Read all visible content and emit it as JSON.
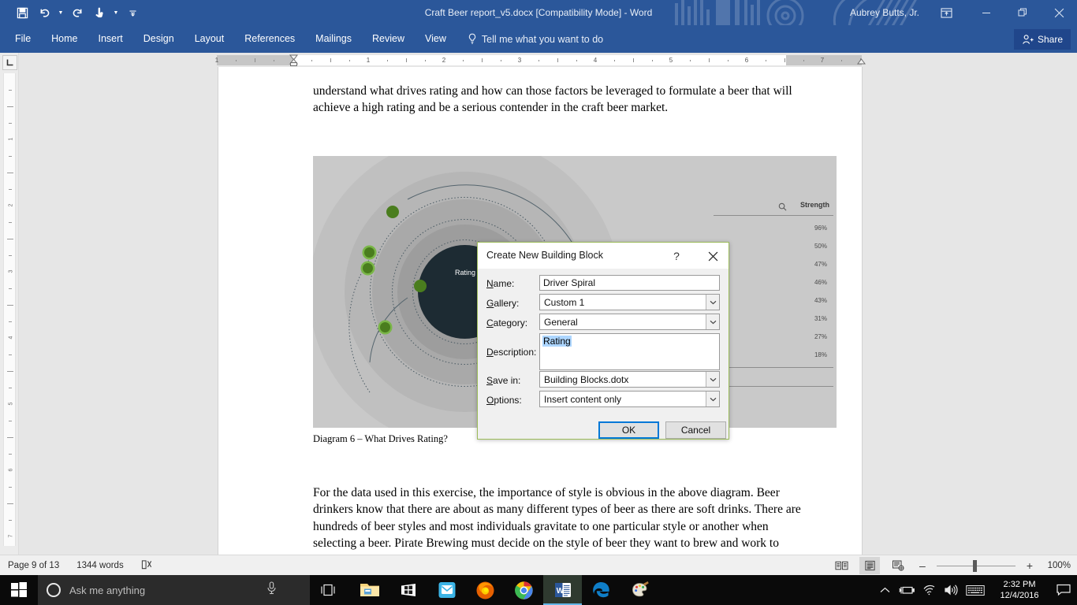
{
  "titlebar": {
    "document_title": "Craft Beer report_v5.docx [Compatibility Mode] - Word",
    "user": "Aubrey Butts, Jr.",
    "quick_access": [
      {
        "name": "save-icon",
        "label": "Save"
      },
      {
        "name": "undo-icon",
        "label": "Undo"
      },
      {
        "name": "redo-icon",
        "label": "Redo"
      },
      {
        "name": "touch-mouse-mode-icon",
        "label": "Touch/Mouse Mode"
      },
      {
        "name": "customize-quick-access-toolbar-icon",
        "label": "Customize Quick Access Toolbar"
      }
    ],
    "window_buttons": {
      "minimize": "–",
      "restore": "❐",
      "close": "✕"
    },
    "ribbon_display_options": "Ribbon Display Options",
    "accent_color": "#2b579a"
  },
  "ribbon": {
    "tabs": [
      {
        "label": "File"
      },
      {
        "label": "Home"
      },
      {
        "label": "Insert"
      },
      {
        "label": "Design"
      },
      {
        "label": "Layout"
      },
      {
        "label": "References"
      },
      {
        "label": "Mailings"
      },
      {
        "label": "Review"
      },
      {
        "label": "View"
      }
    ],
    "tell_me": "Tell me what you want to do",
    "share_label": "Share"
  },
  "ruler": {
    "horizontal_numbers": [
      "1",
      "1",
      "2",
      "3",
      "4",
      "5",
      "6",
      "7"
    ],
    "vertical_numbers": [
      "1",
      "2",
      "3",
      "4",
      "5",
      "6",
      "7"
    ]
  },
  "document": {
    "paragraph_1": "understand what drives rating and how can those factors be leveraged to formulate a beer that will achieve a high rating and be a serious contender in the craft beer market.",
    "caption": "Diagram 6 – What Drives Rating?",
    "paragraph_2": "For the data used in this exercise, the importance of style is obvious in the above diagram.  Beer drinkers know that there are about as many different types of beer as there are soft drinks.  There are hundreds of beer styles and most individuals gravitate to one particular style or another when selecting a beer.  Pirate Brewing must decide on the style of beer they want to brew and work to perfect their particular taste."
  },
  "chart_data": {
    "type": "scatter",
    "title": "What Drives Rating?",
    "center_label": "Rating",
    "column_header": "Strength",
    "values": [
      "96%",
      "50%",
      "47%",
      "46%",
      "43%",
      "31%",
      "27%",
      "18%"
    ],
    "grid": false,
    "legend": "none",
    "dot_color": "#4a7d1e",
    "center_color": "#1d2b33"
  },
  "dialog": {
    "title": "Create New Building Block",
    "help_glyph": "?",
    "close_glyph": "✕",
    "fields": [
      {
        "key": "name",
        "label": "Name:",
        "accel": "N",
        "value": "Driver Spiral",
        "type": "text"
      },
      {
        "key": "gallery",
        "label": "Gallery:",
        "accel": "G",
        "value": "Custom 1",
        "type": "combo"
      },
      {
        "key": "category",
        "label": "Category:",
        "accel": "C",
        "value": "General",
        "type": "combo"
      },
      {
        "key": "description",
        "label": "Description:",
        "accel": "D",
        "value": "Rating",
        "type": "textarea"
      },
      {
        "key": "save_in",
        "label": "Save in:",
        "accel": "S",
        "value": "Building Blocks.dotx",
        "type": "combo"
      },
      {
        "key": "options",
        "label": "Options:",
        "accel": "O",
        "value": "Insert content only",
        "type": "combo"
      }
    ],
    "ok_label": "OK",
    "cancel_label": "Cancel",
    "border_color": "#9bbb59",
    "selection_color": "#add6ff"
  },
  "statusbar": {
    "page": "Page 9 of 13",
    "words": "1344 words",
    "proofing_icon": "spelling-grammar-icon",
    "views": [
      {
        "name": "read-mode-view-button",
        "active": false
      },
      {
        "name": "print-layout-view-button",
        "active": true
      },
      {
        "name": "web-layout-view-button",
        "active": false
      }
    ],
    "zoom_out": "–",
    "zoom_in": "+",
    "zoom_level": "100%"
  },
  "taskbar": {
    "start": "start-button",
    "search_placeholder": "Ask me anything",
    "task_view": "task-view-button",
    "apps": [
      {
        "name": "file-explorer-icon",
        "label": "File Explorer",
        "active": false
      },
      {
        "name": "microsoft-store-icon",
        "label": "Microsoft Store",
        "active": false
      },
      {
        "name": "mail-icon",
        "label": "Mail",
        "active": false
      },
      {
        "name": "firefox-icon",
        "label": "Mozilla Firefox",
        "active": false
      },
      {
        "name": "chrome-icon",
        "label": "Google Chrome",
        "active": false
      },
      {
        "name": "word-icon",
        "label": "Microsoft Word",
        "active": true
      },
      {
        "name": "edge-icon",
        "label": "Microsoft Edge",
        "active": false
      },
      {
        "name": "paint-icon",
        "label": "Paint",
        "active": false
      }
    ],
    "tray": [
      {
        "name": "show-hidden-icons-chevron"
      },
      {
        "name": "battery-icon"
      },
      {
        "name": "wifi-icon"
      },
      {
        "name": "volume-icon"
      },
      {
        "name": "keyboard-icon"
      }
    ],
    "time": "2:32 PM",
    "date": "12/4/2016",
    "action_center": "action-center-button"
  }
}
